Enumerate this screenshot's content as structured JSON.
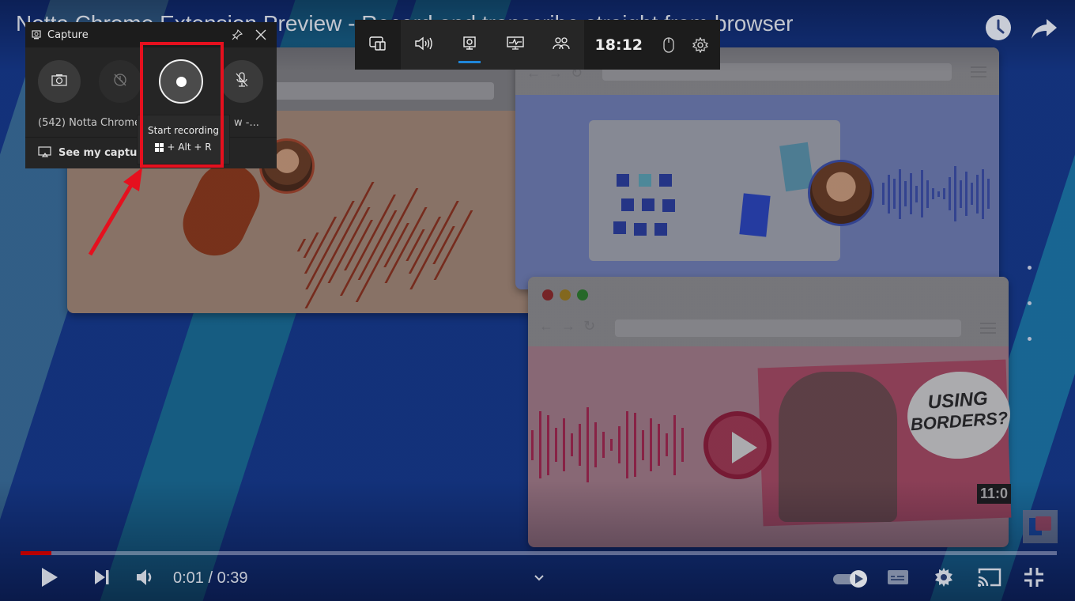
{
  "video": {
    "title": "Notta Chrome Extension Preview - Record and transcribe straight from browser",
    "illustration": {
      "bubble_text_line1": "USING",
      "bubble_text_line2": "BORDERS?",
      "timecode": "11:0"
    },
    "top_actions": [
      {
        "icon": "watch-later-icon",
        "label": "Watch later"
      },
      {
        "icon": "share-icon",
        "label": "Share"
      }
    ]
  },
  "capture_widget": {
    "title": "Capture",
    "header_icon": "capture-widget-icon",
    "pin_icon": "pin-icon",
    "close_icon": "close-icon",
    "buttons": [
      {
        "name": "screenshot",
        "icon": "camera-icon",
        "enabled": true
      },
      {
        "name": "record-last-30s",
        "icon": "record-last-icon",
        "enabled": false
      },
      {
        "name": "start-recording",
        "icon": "record-icon",
        "enabled": true
      },
      {
        "name": "mic-toggle",
        "icon": "mic-off-icon",
        "enabled": true
      }
    ],
    "source_text": "(542) Notta Chrome",
    "source_text_tail": "w -...",
    "see_captures_label": "See my capture",
    "tooltip": {
      "title": "Start recording",
      "shortcut": "+ Alt + R"
    }
  },
  "gamebar": {
    "items": [
      {
        "name": "widget-menu",
        "icon": "widget-menu-icon",
        "active": false
      },
      {
        "name": "audio",
        "icon": "speaker-icon",
        "active": false
      },
      {
        "name": "capture",
        "icon": "capture-icon",
        "active": true
      },
      {
        "name": "performance",
        "icon": "performance-icon",
        "active": false
      },
      {
        "name": "xbox-social",
        "icon": "social-icon",
        "active": false
      }
    ],
    "time": "18:12",
    "mouse_icon": "mouse-icon",
    "settings_icon": "gear-icon",
    "accent": "#1f86d8"
  },
  "player": {
    "current_time": "0:01",
    "duration": "0:39",
    "time_display": "0:01 / 0:39",
    "progress_fraction": 0.03,
    "progress_color": "#b70000",
    "autoplay_on": true,
    "controls_left": [
      "play-icon",
      "next-icon",
      "volume-icon"
    ],
    "controls_right": [
      "autoplay-toggle",
      "subtitles-icon",
      "settings-icon",
      "cast-icon",
      "exit-fullscreen-icon"
    ]
  },
  "annotation": {
    "highlight_color": "#e5101e"
  }
}
